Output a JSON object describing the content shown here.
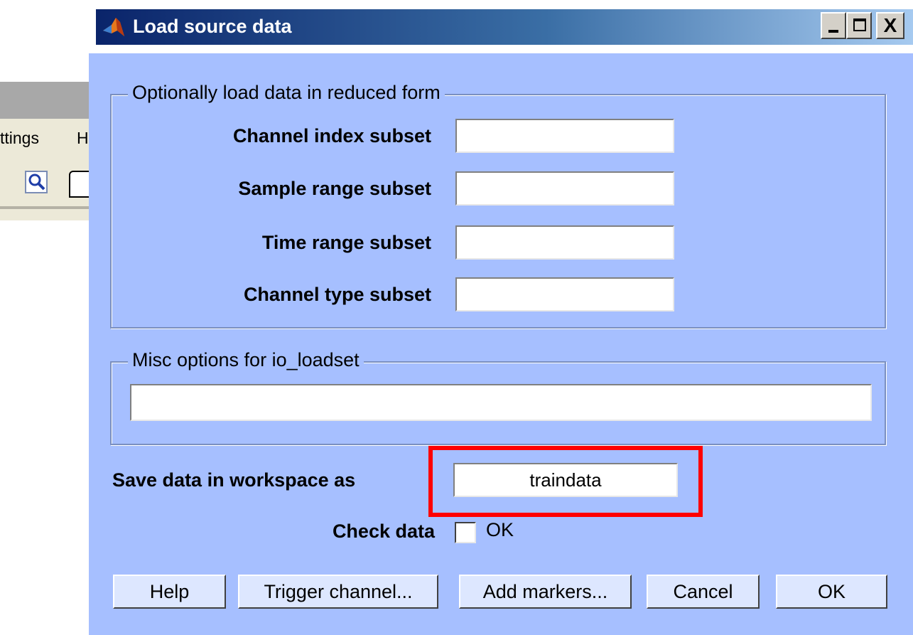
{
  "background_window": {
    "menu_items": [
      "ttings",
      "H"
    ]
  },
  "dialog": {
    "title": "Load source data",
    "window_buttons": {
      "minimize": "_",
      "maximize": "□",
      "close": "X"
    }
  },
  "reduced_form_group": {
    "legend": "Optionally load data in reduced form",
    "fields": [
      {
        "label": "Channel index subset",
        "value": ""
      },
      {
        "label": "Sample range subset",
        "value": ""
      },
      {
        "label": "Time range subset",
        "value": ""
      },
      {
        "label": "Channel type subset",
        "value": ""
      }
    ]
  },
  "misc_group": {
    "legend": "Misc options for io_loadset",
    "value": ""
  },
  "save_as": {
    "label": "Save data in workspace as",
    "value": "traindata"
  },
  "check_data": {
    "label": "Check data",
    "checkbox_label": "OK",
    "checked": false
  },
  "buttons": {
    "help": "Help",
    "trigger": "Trigger channel...",
    "markers": "Add markers...",
    "cancel": "Cancel",
    "ok": "OK"
  },
  "colors": {
    "dialog_bg": "#a6bfff",
    "highlight": "#ff0000",
    "title_gradient_start": "#0a246a"
  }
}
